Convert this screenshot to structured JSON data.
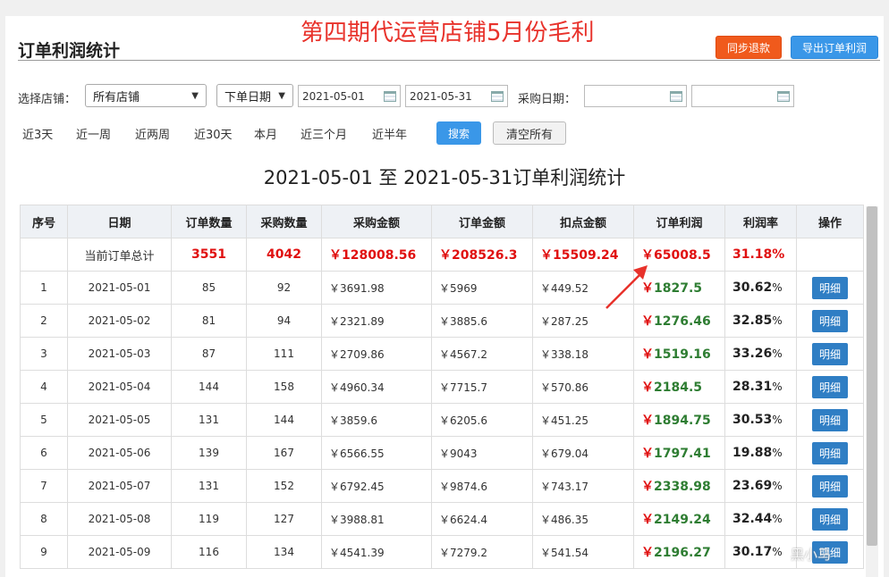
{
  "overlay_title": "第四期代运营店铺5月份毛利",
  "page_title": "订单利润统计",
  "buttons": {
    "sync_refund": "同步退款",
    "export_profit": "导出订单利润",
    "search": "搜索",
    "clear_all": "清空所有"
  },
  "filters": {
    "store_label": "选择店铺：",
    "store_value": "所有店铺",
    "date_type_value": "下单日期",
    "start_date": "2021-05-01",
    "end_date": "2021-05-31",
    "purchase_date_label": "采购日期："
  },
  "quick_ranges": [
    "近3天",
    "近一周",
    "近两周",
    "近30天",
    "本月",
    "近三个月",
    "近半年"
  ],
  "table_heading": "2021-05-01 至 2021-05-31订单利润统计",
  "columns": [
    "序号",
    "日期",
    "订单数量",
    "采购数量",
    "采购金额",
    "订单金额",
    "扣点金额",
    "订单利润",
    "利润率",
    "操作"
  ],
  "total": {
    "label": "当前订单总计",
    "orders": "3551",
    "purchases": "4042",
    "purchase_amount": "￥128008.56",
    "order_amount": "￥208526.3",
    "deduction": "￥15509.24",
    "profit": "￥65008.5",
    "rate": "31.18%"
  },
  "rows": [
    {
      "idx": "1",
      "date": "2021-05-01",
      "orders": "85",
      "purchases": "92",
      "purchase_amount": "￥3691.98",
      "order_amount": "￥5969",
      "deduction": "￥449.52",
      "profit": "1827.5",
      "rate": "30.62",
      "action": "明细"
    },
    {
      "idx": "2",
      "date": "2021-05-02",
      "orders": "81",
      "purchases": "94",
      "purchase_amount": "￥2321.89",
      "order_amount": "￥3885.6",
      "deduction": "￥287.25",
      "profit": "1276.46",
      "rate": "32.85",
      "action": "明细"
    },
    {
      "idx": "3",
      "date": "2021-05-03",
      "orders": "87",
      "purchases": "111",
      "purchase_amount": "￥2709.86",
      "order_amount": "￥4567.2",
      "deduction": "￥338.18",
      "profit": "1519.16",
      "rate": "33.26",
      "action": "明细"
    },
    {
      "idx": "4",
      "date": "2021-05-04",
      "orders": "144",
      "purchases": "158",
      "purchase_amount": "￥4960.34",
      "order_amount": "￥7715.7",
      "deduction": "￥570.86",
      "profit": "2184.5",
      "rate": "28.31",
      "action": "明细"
    },
    {
      "idx": "5",
      "date": "2021-05-05",
      "orders": "131",
      "purchases": "144",
      "purchase_amount": "￥3859.6",
      "order_amount": "￥6205.6",
      "deduction": "￥451.25",
      "profit": "1894.75",
      "rate": "30.53",
      "action": "明细"
    },
    {
      "idx": "6",
      "date": "2021-05-06",
      "orders": "139",
      "purchases": "167",
      "purchase_amount": "￥6566.55",
      "order_amount": "￥9043",
      "deduction": "￥679.04",
      "profit": "1797.41",
      "rate": "19.88",
      "action": "明细"
    },
    {
      "idx": "7",
      "date": "2021-05-07",
      "orders": "131",
      "purchases": "152",
      "purchase_amount": "￥6792.45",
      "order_amount": "￥9874.6",
      "deduction": "￥743.17",
      "profit": "2338.98",
      "rate": "23.69",
      "action": "明细"
    },
    {
      "idx": "8",
      "date": "2021-05-08",
      "orders": "119",
      "purchases": "127",
      "purchase_amount": "￥3988.81",
      "order_amount": "￥6624.4",
      "deduction": "￥486.35",
      "profit": "2149.24",
      "rate": "32.44",
      "action": "明细"
    },
    {
      "idx": "9",
      "date": "2021-05-09",
      "orders": "116",
      "purchases": "134",
      "purchase_amount": "￥4541.39",
      "order_amount": "￥7279.2",
      "deduction": "￥541.54",
      "profit": "2196.27",
      "rate": "30.17",
      "action": "明细"
    }
  ],
  "currency_symbol": "￥",
  "percent_symbol": "%",
  "watermark": "黑小马",
  "colors": {
    "accent_red": "#e8322b",
    "profit_green": "#2e7d32",
    "primary_blue": "#3a97e8",
    "sync_orange": "#f05a1c"
  },
  "icons": [
    "calendar-icon",
    "chevron-down-icon",
    "annotation-arrow"
  ]
}
